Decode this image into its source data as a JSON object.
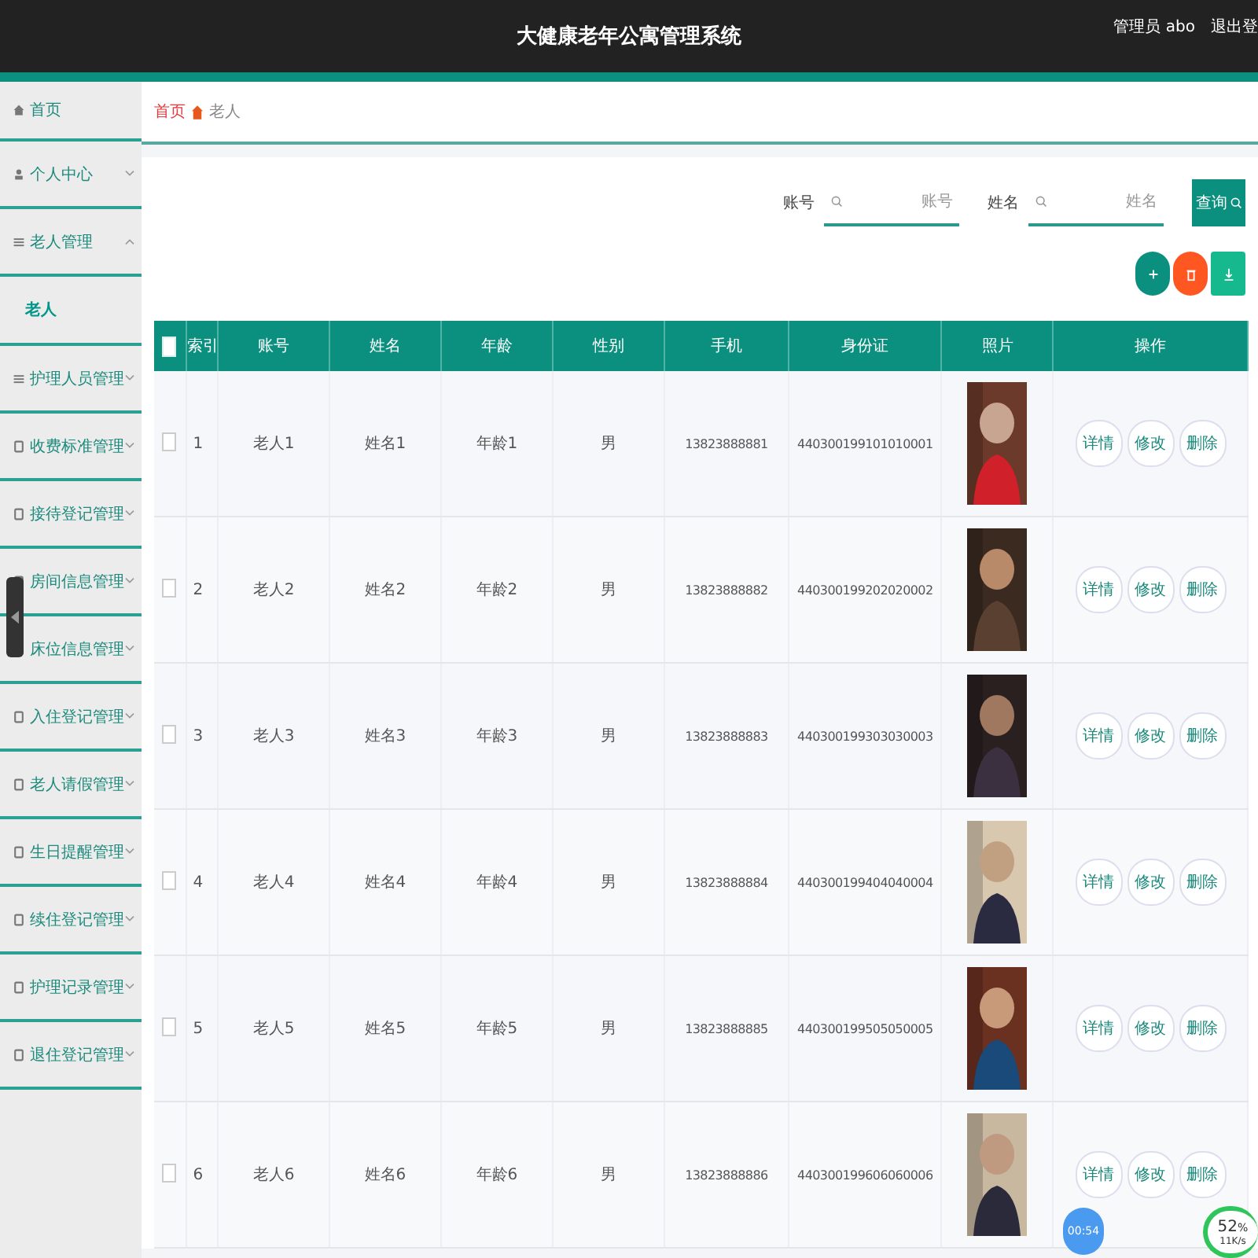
{
  "header": {
    "title": "大健康老年公寓管理系统",
    "user": "管理员 abo",
    "logout": "退出登"
  },
  "sidebar": {
    "items": [
      {
        "label": "首页",
        "kind": "link",
        "selected": false
      },
      {
        "label": "个人中心",
        "kind": "menu",
        "expanded": false,
        "selected": false
      },
      {
        "label": "老人管理",
        "kind": "menu",
        "expanded": true,
        "selected": false,
        "children": [
          {
            "label": "老人",
            "selected": true
          }
        ]
      },
      {
        "label": "护理人员管理",
        "kind": "menu",
        "expanded": false,
        "selected": false
      },
      {
        "label": "收费标准管理",
        "kind": "menu",
        "expanded": false,
        "selected": false
      },
      {
        "label": "接待登记管理",
        "kind": "menu",
        "expanded": false,
        "selected": false
      },
      {
        "label": "房间信息管理",
        "kind": "menu",
        "expanded": false,
        "selected": false
      },
      {
        "label": "床位信息管理",
        "kind": "menu",
        "expanded": false,
        "selected": false
      },
      {
        "label": "入住登记管理",
        "kind": "menu",
        "expanded": false,
        "selected": false
      },
      {
        "label": "老人请假管理",
        "kind": "menu",
        "expanded": false,
        "selected": false
      },
      {
        "label": "生日提醒管理",
        "kind": "menu",
        "expanded": false,
        "selected": false
      },
      {
        "label": "续住登记管理",
        "kind": "menu",
        "expanded": false,
        "selected": false
      },
      {
        "label": "护理记录管理",
        "kind": "menu",
        "expanded": false,
        "selected": false
      },
      {
        "label": "退住登记管理",
        "kind": "menu",
        "expanded": false,
        "selected": false
      }
    ]
  },
  "breadcrumb": [
    "首页",
    "老人"
  ],
  "search": {
    "fields": [
      {
        "label": "账号",
        "placeholder": "账号"
      },
      {
        "label": "姓名",
        "placeholder": "姓名"
      }
    ],
    "button": "查询"
  },
  "actions": [
    {
      "kind": "add"
    },
    {
      "kind": "delete"
    },
    {
      "kind": "export"
    }
  ],
  "table": {
    "all_checked": false,
    "columns": [
      "索引",
      "账号",
      "姓名",
      "年龄",
      "性别",
      "手机",
      "身份证",
      "照片",
      "操作"
    ],
    "rows": [
      {
        "checked": false,
        "index": "1",
        "account": "老人1",
        "name": "姓名1",
        "age": "年龄1",
        "gender": "男",
        "phone": "13823888881",
        "id_card": "440300199101010001",
        "buttons": [
          "详情",
          "修改",
          "删除"
        ]
      },
      {
        "checked": false,
        "index": "2",
        "account": "老人2",
        "name": "姓名2",
        "age": "年龄2",
        "gender": "男",
        "phone": "13823888882",
        "id_card": "440300199202020002",
        "buttons": [
          "详情",
          "修改",
          "删除"
        ]
      },
      {
        "checked": false,
        "index": "3",
        "account": "老人3",
        "name": "姓名3",
        "age": "年龄3",
        "gender": "男",
        "phone": "13823888883",
        "id_card": "440300199303030003",
        "buttons": [
          "详情",
          "修改",
          "删除"
        ]
      },
      {
        "checked": false,
        "index": "4",
        "account": "老人4",
        "name": "姓名4",
        "age": "年龄4",
        "gender": "男",
        "phone": "13823888884",
        "id_card": "440300199404040004",
        "buttons": [
          "详情",
          "修改",
          "删除"
        ]
      },
      {
        "checked": false,
        "index": "5",
        "account": "老人5",
        "name": "姓名5",
        "age": "年龄5",
        "gender": "男",
        "phone": "13823888885",
        "id_card": "440300199505050005",
        "buttons": [
          "详情",
          "修改",
          "删除"
        ]
      },
      {
        "checked": false,
        "index": "6",
        "account": "老人6",
        "name": "姓名6",
        "age": "年龄6",
        "gender": "男",
        "phone": "13823888886",
        "id_card": "440300199606060006",
        "buttons": [
          "详情",
          "修改",
          "删除"
        ]
      }
    ]
  },
  "overlays": {
    "timer": "00:54",
    "meter": {
      "percent": "52",
      "unit": "%",
      "speed": "11K/s"
    }
  }
}
